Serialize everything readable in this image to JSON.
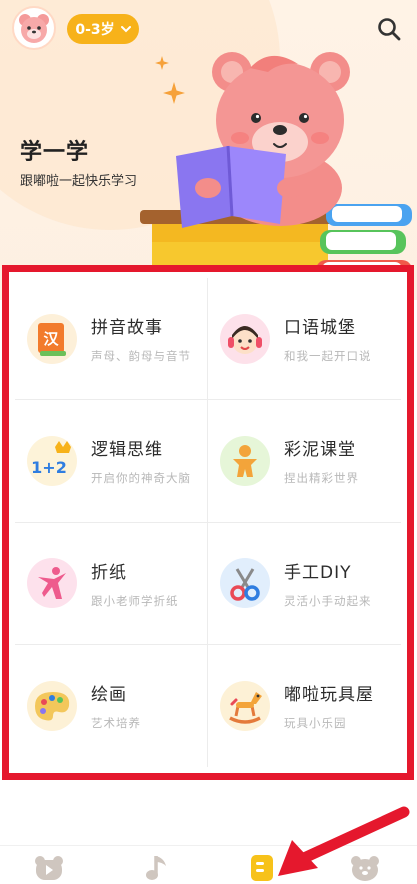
{
  "header": {
    "age_label": "0-3岁",
    "title": "学一学",
    "subtitle": "跟嘟啦一起快乐学习"
  },
  "grid": {
    "items": [
      {
        "title": "拼音故事",
        "desc": "声母、韵母与音节",
        "icon": "chinese-book-icon"
      },
      {
        "title": "口语城堡",
        "desc": "和我一起开口说",
        "icon": "girl-headphones-icon"
      },
      {
        "title": "逻辑思维",
        "desc": "开启你的神奇大脑",
        "icon": "math-crown-icon"
      },
      {
        "title": "彩泥课堂",
        "desc": "捏出精彩世界",
        "icon": "clay-figure-icon"
      },
      {
        "title": "折纸",
        "desc": "跟小老师学折纸",
        "icon": "dancer-origami-icon"
      },
      {
        "title": "手工DIY",
        "desc": "灵活小手动起来",
        "icon": "scissors-icon"
      },
      {
        "title": "绘画",
        "desc": "艺术培养",
        "icon": "palette-icon"
      },
      {
        "title": "嘟啦玩具屋",
        "desc": "玩具小乐园",
        "icon": "rocking-horse-icon"
      }
    ]
  },
  "bottom_nav": {
    "items": [
      {
        "icon": "bear-play-icon"
      },
      {
        "icon": "music-note-icon"
      },
      {
        "icon": "learn-book-icon",
        "active": true
      },
      {
        "icon": "bear-profile-icon"
      }
    ]
  },
  "colors": {
    "accent": "#f7b21a",
    "highlight_border": "#e5182d",
    "arrow": "#e5182d"
  }
}
